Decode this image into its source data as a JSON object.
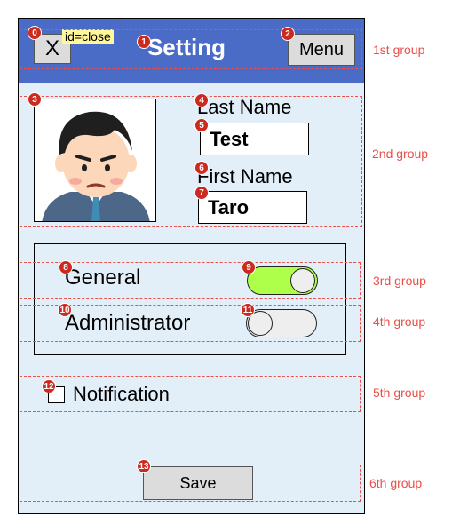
{
  "header": {
    "close_label": "X",
    "close_tooltip": "id=close",
    "title": "Setting",
    "menu_label": "Menu"
  },
  "profile": {
    "last_name_label": "Last Name",
    "last_name_value": "Test",
    "first_name_label": "First Name",
    "first_name_value": "Taro"
  },
  "roles": [
    {
      "label": "General",
      "enabled": true,
      "accent": "#adff4a"
    },
    {
      "label": "Administrator",
      "enabled": false
    }
  ],
  "notification": {
    "label": "Notification",
    "checked": false
  },
  "save_label": "Save",
  "groups": [
    "1st group",
    "2nd group",
    "3rd group",
    "4th group",
    "5th group",
    "6th group"
  ],
  "markers": [
    "0",
    "1",
    "2",
    "3",
    "4",
    "5",
    "6",
    "7",
    "8",
    "9",
    "10",
    "11",
    "12",
    "13"
  ]
}
